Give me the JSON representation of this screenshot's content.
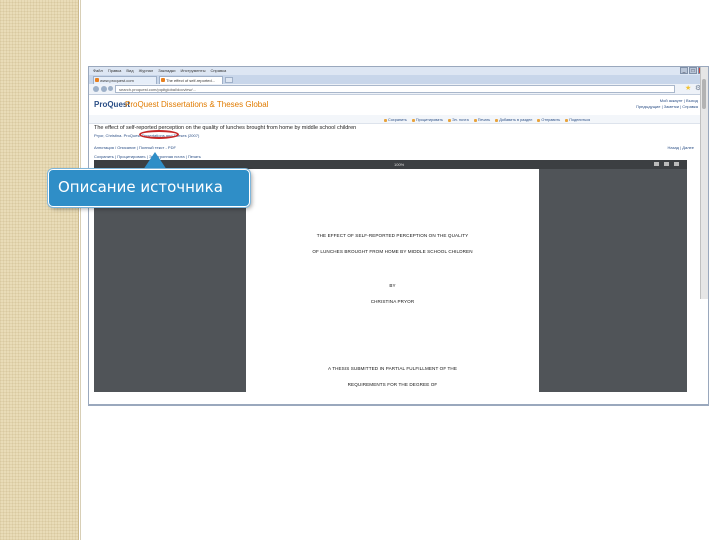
{
  "browser": {
    "menu": [
      "Файл",
      "Правка",
      "Вид",
      "Журнал",
      "Закладки",
      "Инструменты",
      "Справка"
    ],
    "tabs": [
      {
        "label": "www.proquest.com"
      },
      {
        "label": "The effect of self-reported..."
      }
    ],
    "url": "search.proquest.com/pqdtglobal/docview/...",
    "window_controls": [
      "_",
      "□",
      "✕"
    ]
  },
  "proquest": {
    "logo": "ProQuest",
    "title": "ProQuest Dissertations & Theses Global",
    "links_top": "Мой аккаунт  |  Выход",
    "links_bottom": "Предыдущие  |  Заметки  |  Справка"
  },
  "document": {
    "title": "The effect of self-reported perception on the quality of lunches brought from home by middle school children",
    "meta": "Pryor, Christina. ProQuest Dissertations and Theses (2007)",
    "links": "Аннотация / Описание  |  Полный текст - PDF",
    "links2": "Сохранить  |  Процитировать  |  Электронная почта  |  Печать",
    "nav": "Назад  |  Далее"
  },
  "tools": [
    "Сохранить",
    "Процитировать",
    "Эл. почта",
    "Печать",
    "Добавить в раздел",
    "Отправить",
    "Поделиться"
  ],
  "pdf": {
    "zoom": "100%",
    "lines": [
      "THE EFFECT OF SELF-REPORTED PERCEPTION ON THE QUALITY",
      "OF LUNCHES BROUGHT FROM HOME BY MIDDLE SCHOOL CHILDREN",
      "BY",
      "CHRISTINA PRYOR",
      "A THESIS SUBMITTED IN PARTIAL FULFILLMENT OF THE",
      "REQUIREMENTS FOR THE DEGREE OF"
    ]
  },
  "callout": {
    "text": "Описание источника"
  }
}
